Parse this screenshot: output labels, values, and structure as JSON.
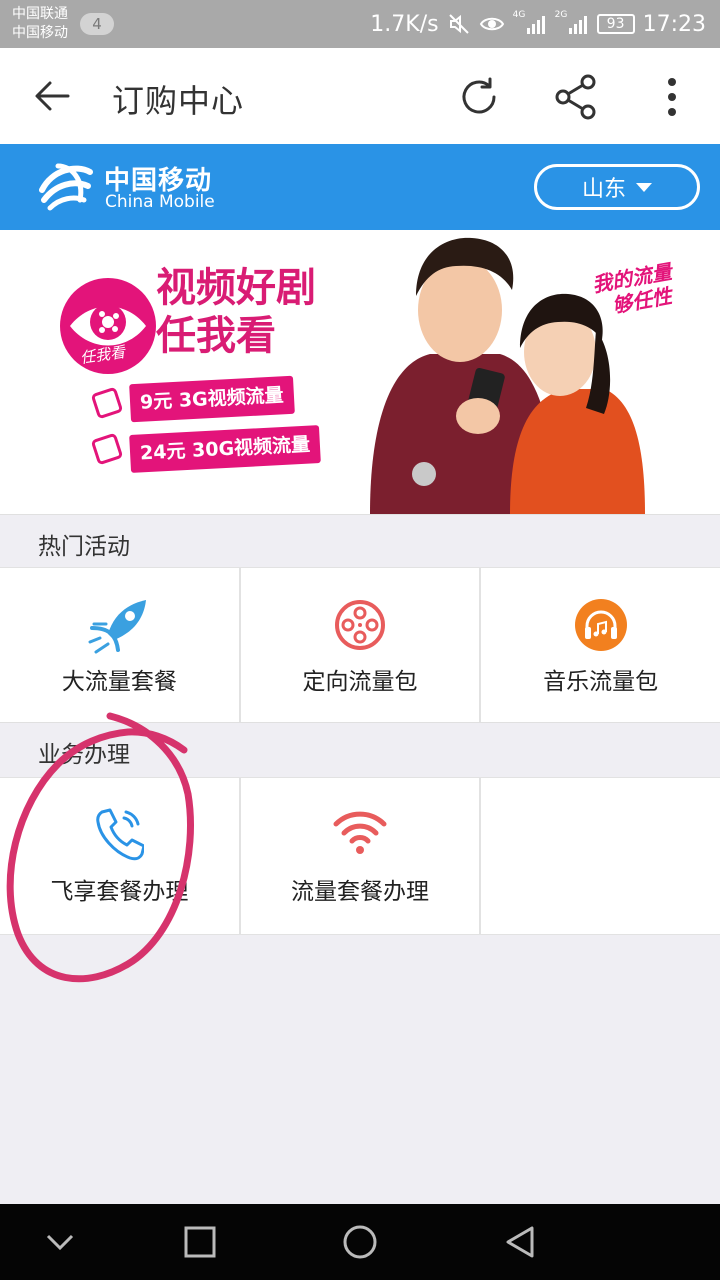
{
  "status_bar": {
    "carrier_1": "中国联通",
    "carrier_2": "中国移动",
    "notification_count": "4",
    "network_speed": "1.7K/s",
    "signal_1_label": "4G",
    "signal_2_label": "2G",
    "battery": "93",
    "time": "17:23"
  },
  "title_bar": {
    "title": "订购中心"
  },
  "brand": {
    "name_cn": "中国移动",
    "name_en": "China Mobile",
    "region": "山东"
  },
  "banner": {
    "eye_label": "任我看",
    "headline_1": "视频好剧",
    "headline_2": "任我看",
    "offer_1": "9元 3G视频流量",
    "offer_2": "24元 30G视频流量",
    "slogan_1": "我的流量",
    "slogan_2": "够任性"
  },
  "sections": {
    "hot": {
      "title": "热门活动",
      "items": [
        {
          "label": "大流量套餐",
          "icon": "rocket-icon"
        },
        {
          "label": "定向流量包",
          "icon": "film-reel-icon"
        },
        {
          "label": "音乐流量包",
          "icon": "headphones-icon"
        }
      ]
    },
    "business": {
      "title": "业务办理",
      "items": [
        {
          "label": "飞享套餐办理",
          "icon": "phone-call-icon"
        },
        {
          "label": "流量套餐办理",
          "icon": "wifi-icon"
        }
      ]
    }
  },
  "colors": {
    "brand_blue": "#2a93e6",
    "promo_pink": "#e3147a",
    "annotation": "#d6336c"
  }
}
